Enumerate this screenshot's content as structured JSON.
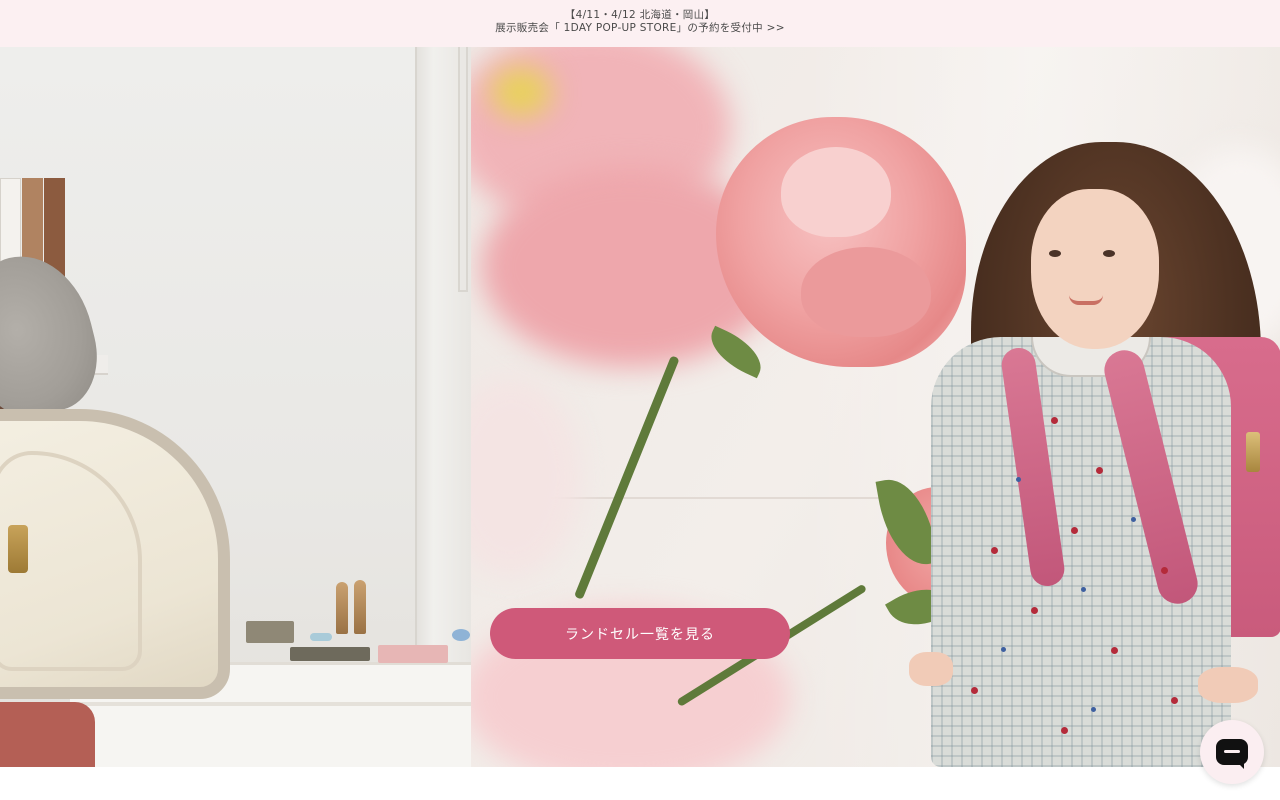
{
  "announcement": {
    "line1": "【4/11・4/12 北海道・岡山】",
    "line2": "展示販売会「 1DAY POP-UP STORE」の予約を受付中 >>"
  },
  "hero": {
    "cta_label": "ランドセル一覧を見る"
  },
  "chat": {
    "icon": "chat-icon"
  },
  "colors": {
    "announcement_bg": "#fcf0f2",
    "cta_bg": "#cf5979",
    "cta_text": "#ffffff",
    "chat_bg": "#fbeef1"
  }
}
